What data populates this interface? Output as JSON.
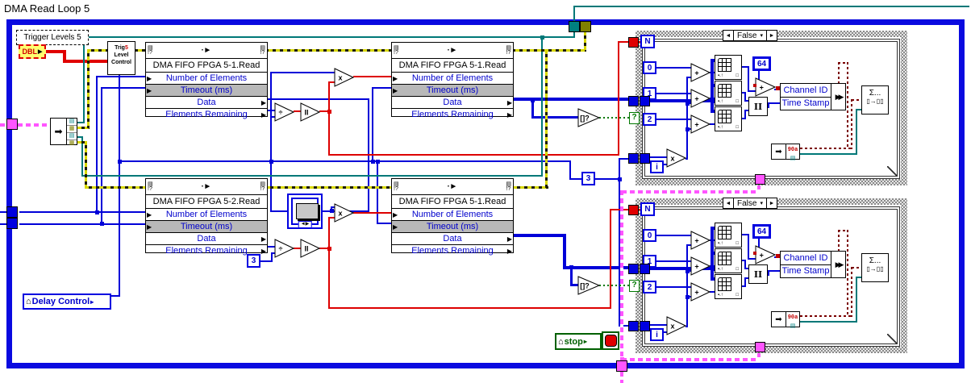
{
  "window_title": "DMA Read Loop 5",
  "trigger_label": "Trigger Levels 5",
  "dbl_constant": "DBL",
  "trig_level_control": {
    "line1": "Trig",
    "line1_sup": "5",
    "line2": "Level",
    "line3": "Control"
  },
  "delay_control_label": "Delay Control",
  "stop_button_label": "stop",
  "constants": {
    "three_top": "3",
    "three_bottom": "3"
  },
  "operator_glyphs": {
    "divide": "÷",
    "multiply": "x",
    "add": "+",
    "round": "II",
    "empty_array": "[]?"
  },
  "dma_nodes": [
    {
      "title": "DMA FIFO FPGA 5-1.Read",
      "rows": [
        "Number of Elements",
        "Timeout (ms)",
        "Data",
        "Elements Remaining"
      ]
    },
    {
      "title": "DMA FIFO FPGA 5-1.Read",
      "rows": [
        "Number of Elements",
        "Timeout (ms)",
        "Data",
        "Elements Remaining"
      ]
    },
    {
      "title": "DMA FIFO FPGA 5-2.Read",
      "rows": [
        "Number of Elements",
        "Timeout (ms)",
        "Data",
        "Elements Remaining"
      ]
    },
    {
      "title": "DMA FIFO FPGA 5-1.Read",
      "rows": [
        "Number of Elements",
        "Timeout (ms)",
        "Data",
        "Elements Remaining"
      ]
    }
  ],
  "case_structures": [
    {
      "selector": "False",
      "loop_count": "N",
      "iterator": "i",
      "offsets": [
        "0",
        "1",
        "2"
      ],
      "word_size": "64",
      "selector_terminal": "?",
      "bundle_fields": [
        "Channel ID",
        "Time Stamp"
      ],
      "sigma_label": "Σ...",
      "sub_icon_label": "90a"
    },
    {
      "selector": "False",
      "loop_count": "N",
      "iterator": "i",
      "offsets": [
        "0",
        "1",
        "2"
      ],
      "word_size": "64",
      "selector_terminal": "?",
      "bundle_fields": [
        "Channel ID",
        "Time Stamp"
      ],
      "sigma_label": "Σ...",
      "sub_icon_label": "90a"
    }
  ],
  "glyphs": {
    "selector_left": "◄",
    "selector_right": "►",
    "selector_down": "▾",
    "house": "⌂",
    "row_arrow": "▶",
    "node_corner": "▤\n!?",
    "node_center": "∙►",
    "page": "▤",
    "grid": "▦",
    "bundle_arrows": "▶▶",
    "sigma_bottom": "▯→▯▯",
    "subvi_arrows": "◄▶",
    "big_arrow": "►"
  },
  "colors": {
    "loop_border": "#0a0ae0",
    "wire_blue": "#0000d8",
    "wire_red": "#dd0000",
    "wire_teal": "#007878",
    "wire_yellow": "#d8d800",
    "wire_magenta": "#ff55ff",
    "wire_green": "#007800",
    "cluster_brown": "#7a0000",
    "text_blue": "#0000cc",
    "timeout_gray": "#b8b8b8"
  }
}
